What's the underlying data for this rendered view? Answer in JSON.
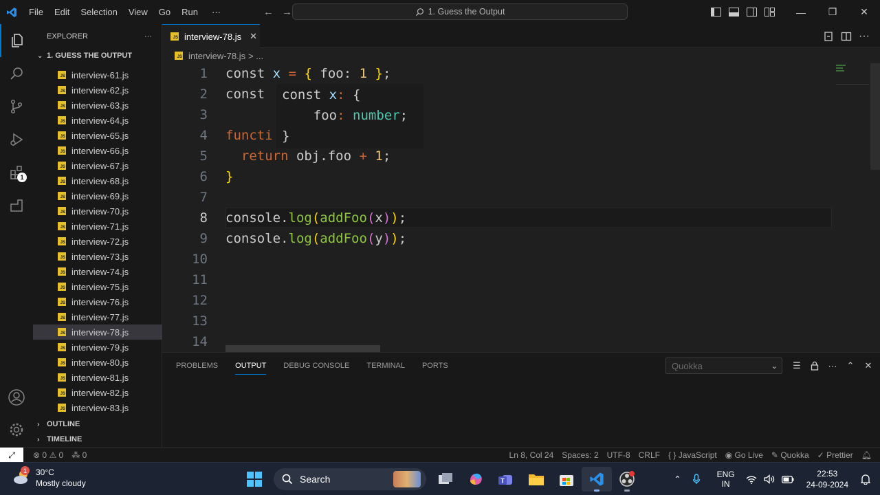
{
  "titlebar": {
    "menu": [
      "File",
      "Edit",
      "Selection",
      "View",
      "Go",
      "Run",
      "···"
    ],
    "search": "1. Guess the Output",
    "controls": {
      "minimize": "—",
      "restore": "❐",
      "close": "✕"
    }
  },
  "sidebar": {
    "title": "EXPLORER",
    "more": "···",
    "folder": "1. GUESS THE OUTPUT",
    "files": [
      "interview-61.js",
      "interview-62.js",
      "interview-63.js",
      "interview-64.js",
      "interview-65.js",
      "interview-66.js",
      "interview-67.js",
      "interview-68.js",
      "interview-69.js",
      "interview-70.js",
      "interview-71.js",
      "interview-72.js",
      "interview-73.js",
      "interview-74.js",
      "interview-75.js",
      "interview-76.js",
      "interview-77.js",
      "interview-78.js",
      "interview-79.js",
      "interview-80.js",
      "interview-81.js",
      "interview-82.js",
      "interview-83.js"
    ],
    "selected_index": 17,
    "outline": "OUTLINE",
    "timeline": "TIMELINE",
    "extensions_badge": "1"
  },
  "editor": {
    "tab": "interview-78.js",
    "tab_close": "✕",
    "breadcrumb_file": "interview-78.js",
    "breadcrumb_more": "> ...",
    "line_numbers": [
      "1",
      "2",
      "3",
      "4",
      "5",
      "6",
      "7",
      "8",
      "9",
      "10",
      "11",
      "12",
      "13",
      "14"
    ],
    "active_line": 8,
    "hover": {
      "l1_kw": "const",
      "l1_name": "x",
      "l1_colon": ":",
      "l1_brace": "{",
      "l2_prop": "foo",
      "l2_colon": ":",
      "l2_type": "number",
      "l2_semi": ";",
      "l3_brace": "}"
    }
  },
  "panel": {
    "tabs": [
      "PROBLEMS",
      "OUTPUT",
      "DEBUG CONSOLE",
      "TERMINAL",
      "PORTS"
    ],
    "active_tab": "OUTPUT",
    "channel": "Quokka"
  },
  "statusbar": {
    "errors": "0",
    "warnings": "0",
    "ports": "0",
    "position": "Ln 8, Col 24",
    "spaces": "Spaces: 2",
    "encoding": "UTF-8",
    "eol": "CRLF",
    "language": "JavaScript",
    "golive": "Go Live",
    "quokka": "Quokka",
    "prettier": "Prettier"
  },
  "taskbar": {
    "weather_temp": "30°C",
    "weather_desc": "Mostly cloudy",
    "weather_badge": "1",
    "search": "Search",
    "lang_top": "ENG",
    "lang_bottom": "IN",
    "time": "22:53",
    "date": "24-09-2024"
  },
  "colors": {
    "accent": "#0078d4",
    "editor_bg": "#1f1f1f",
    "js_icon": "#e5c02b"
  }
}
